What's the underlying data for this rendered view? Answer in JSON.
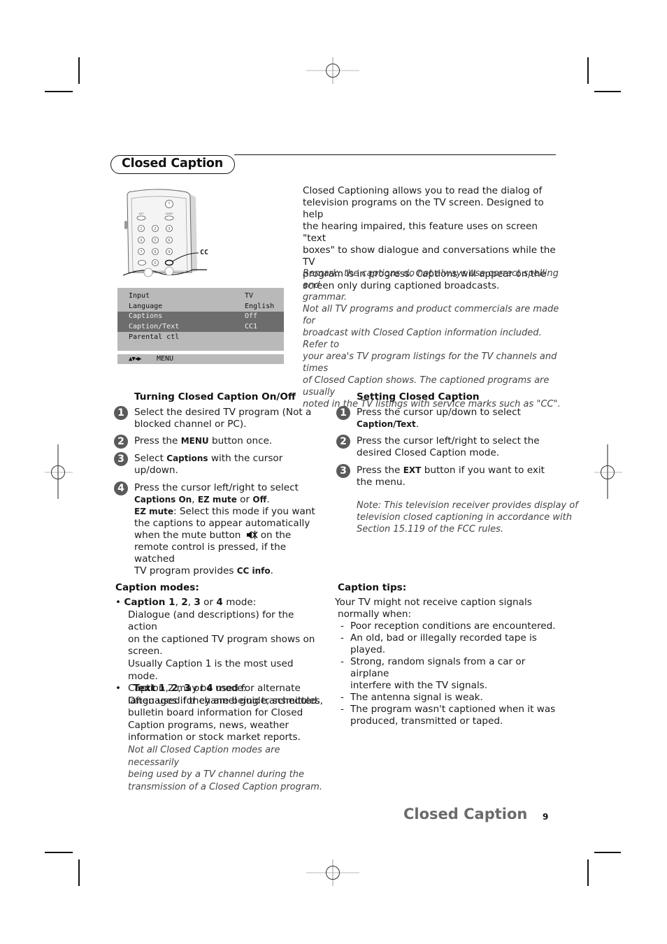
{
  "header": {
    "section_title": "Closed Caption"
  },
  "remote_illustration": {
    "callout_label": "CC",
    "button_labels": [
      "EXT",
      "SLEEP"
    ],
    "number_keys": [
      "1",
      "2",
      "3",
      "4",
      "5",
      "6",
      "7",
      "8",
      "9",
      "0"
    ]
  },
  "tv_menu": {
    "rows": [
      {
        "label": "Input",
        "value": "TV",
        "highlighted": false
      },
      {
        "label": "Language",
        "value": "English",
        "highlighted": false
      },
      {
        "label": "Captions",
        "value": "Off",
        "highlighted": true
      },
      {
        "label": "Caption/Text",
        "value": "CC1",
        "highlighted": true
      },
      {
        "label": "Parental ctl",
        "value": "",
        "highlighted": false
      }
    ],
    "footer_arrows": "▲▼◀▶",
    "footer_label": "MENU"
  },
  "intro": {
    "paragraph": "Closed Captioning allows you to read the dialog of television programs on the TV screen.  Designed to help the hearing impaired, this feature uses on screen \"text boxes\" to show dialogue and conversations while the TV program is in progress. Captions will appear on the screen only during captioned broadcasts.",
    "lines": [
      "Closed Captioning allows you to read the dialog of",
      "television programs on the TV screen.  Designed to help",
      "the hearing impaired, this feature uses on screen \"text",
      "boxes\" to show dialogue and conversations while the TV",
      "program is in progress. Captions will appear on the",
      "screen only during captioned broadcasts."
    ],
    "remark_lines": [
      "Remark: the captions do not always use correct spelling and",
      "grammar.",
      "Not all TV programs and product commercials are made for",
      "broadcast with Closed Caption information included.  Refer to",
      "your area's TV program listings for the TV channels and times",
      "of Closed Caption shows.  The captioned programs are usually",
      "noted in the TV listings with service marks such as \"CC\"."
    ]
  },
  "turning_on_off": {
    "heading": "Turning Closed Caption On/Off",
    "steps": [
      {
        "number": "1",
        "lines": [
          "Select the desired TV program (Not a",
          "blocked channel or PC)."
        ]
      },
      {
        "number": "2",
        "pre": "Press the ",
        "bold": "MENU",
        "post": " button once."
      },
      {
        "number": "3",
        "pre": "Select ",
        "bold": "Captions",
        "post": " with the cursor",
        "line2": "up/down."
      },
      {
        "number": "4",
        "line1": "Press the cursor left/right to select",
        "opt1": "Captions On",
        "sep1": ", ",
        "opt2": "EZ mute",
        "sep2": " or ",
        "opt3": "Off",
        "end": ".",
        "ez_label": "EZ mute",
        "ez_text": ": Select this mode if you want",
        "line4": "the captions to appear automatically",
        "line5_pre": "when the mute button",
        "line5_post": "on the",
        "line6": "remote control is pressed, if the watched",
        "line7_pre": "TV program provides ",
        "line7_bold": "CC info",
        "line7_post": "."
      }
    ]
  },
  "setting": {
    "heading": "Setting Closed Caption",
    "steps": [
      {
        "number": "1",
        "line1": "Press the cursor up/down to select",
        "bold": "Caption/Text",
        "post": "."
      },
      {
        "number": "2",
        "lines": [
          "Press the cursor left/right to select the",
          "desired Closed Caption mode."
        ]
      },
      {
        "number": "3",
        "pre": "Press the ",
        "bold": "EXT",
        "post": " button if you want to exit",
        "line2": "the menu."
      }
    ],
    "note_lines": [
      "Note: This television receiver provides display of",
      "television closed captioning in accordance with",
      "Section 15.119 of the FCC rules."
    ]
  },
  "caption_modes": {
    "heading": "Caption modes:",
    "item1": {
      "bullet": "•",
      "b1": "Caption 1",
      "c1": ", ",
      "b2": "2",
      "c2": ", ",
      "b3": "3",
      "c3": " or ",
      "b4": "4",
      "tail": " mode:",
      "lines": [
        "Dialogue (and descriptions) for the action",
        "on the captioned TV program shows on",
        "screen.",
        "Usually Caption 1 is the most used mode.",
        "Caption 2 may be used for alternate",
        "languages if they are being transmitted."
      ]
    },
    "item2": {
      "bullet": "•",
      "b1": "Text 1",
      "c1": ", ",
      "b2": "2",
      "c2": ", ",
      "b3": "3",
      "c3": " or ",
      "b4": "4",
      "tail": " mode:",
      "lines": [
        "Often used for channel guide, schedules,",
        "bulletin board information for Closed",
        "Caption programs, news, weather",
        "information or stock market reports."
      ],
      "note_lines": [
        "Not all Closed Caption modes are necessarily",
        "being used by a TV channel during the",
        "transmission of a Closed Caption program."
      ]
    }
  },
  "caption_tips": {
    "heading": "Caption tips:",
    "intro_lines": [
      "Your TV might not receive caption signals",
      "normally when:"
    ],
    "items": [
      {
        "lines": [
          "Poor reception conditions are encountered."
        ]
      },
      {
        "lines": [
          "An old, bad or illegally recorded tape is",
          "played."
        ]
      },
      {
        "lines": [
          "Strong, random signals from a car or airplane",
          "interfere with the TV signals."
        ]
      },
      {
        "lines": [
          "The antenna signal is weak."
        ]
      },
      {
        "lines": [
          "The program wasn't captioned when it was",
          "produced, transmitted or taped."
        ]
      }
    ],
    "dash": "-"
  },
  "footer": {
    "title": "Closed Caption",
    "page_number": "9"
  }
}
